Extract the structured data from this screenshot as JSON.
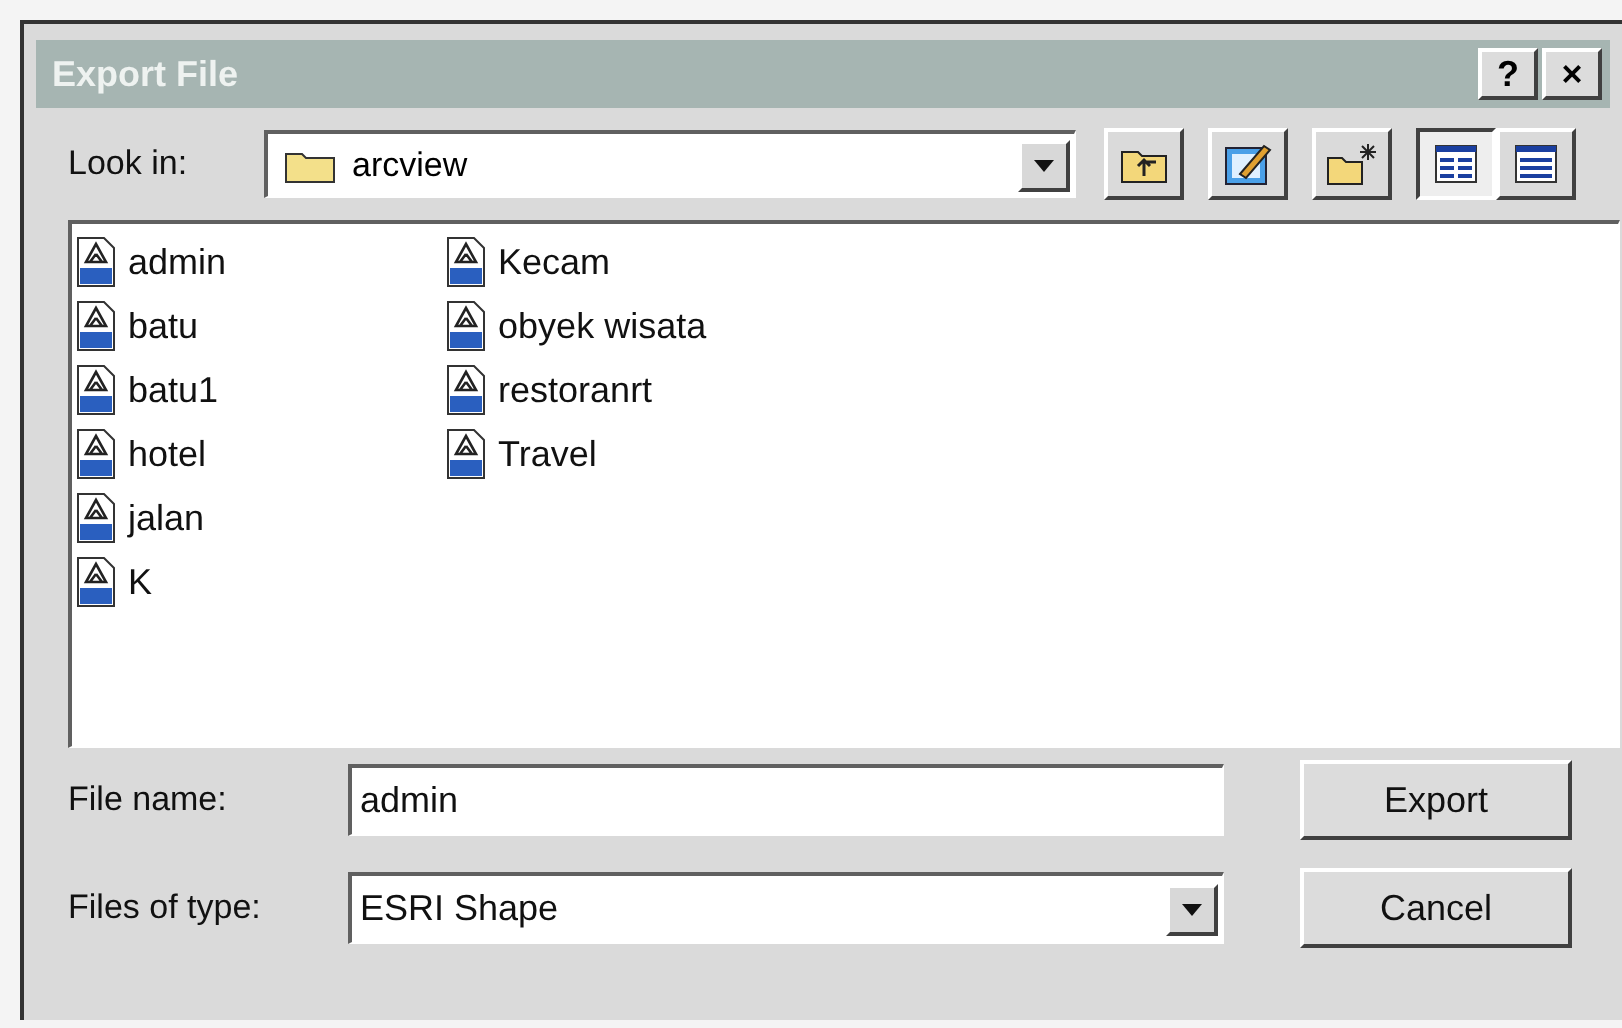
{
  "window": {
    "title": "Export File",
    "title_buttons": [
      "?",
      "×"
    ]
  },
  "look_in": {
    "label": "Look in:",
    "value": "arcview"
  },
  "toolbar": [
    {
      "kind": "up",
      "selected": false
    },
    {
      "kind": "edit",
      "selected": false
    },
    {
      "kind": "new-folder",
      "selected": false
    },
    {
      "kind": "list-view",
      "selected": true
    },
    {
      "kind": "details-view",
      "selected": false
    }
  ],
  "files": [
    "admin",
    "batu",
    "batu1",
    "hotel",
    "jalan",
    "K",
    "Kecam",
    "obyek wisata",
    "restoranrt",
    "Travel"
  ],
  "file_name": {
    "label": "File name:",
    "value": "admin"
  },
  "file_type": {
    "label": "Files of type:",
    "value": "ESRI Shape"
  },
  "buttons": [
    "Export",
    "Cancel"
  ]
}
